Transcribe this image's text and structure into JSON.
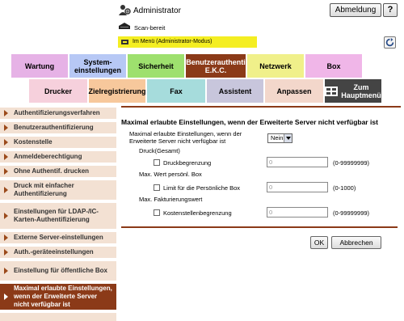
{
  "header": {
    "user": "Administrator",
    "logout_label": "Abmeldung",
    "help_label": "?",
    "status": "Scan-bereit",
    "mode": "Im Menü (Administrator-Modus)"
  },
  "tabs_row1": [
    {
      "label": "Wartung",
      "color": "#e6b2e6"
    },
    {
      "label": "System-\neinstellungen",
      "color": "#b7c8f5"
    },
    {
      "label": "Sicherheit",
      "color": "#9ee06e"
    },
    {
      "label": "Benutzerauthenti\nE.K.C.",
      "color": "#8b3a18",
      "active": true
    },
    {
      "label": "Netzwerk",
      "color": "#f0f08a"
    },
    {
      "label": "Box",
      "color": "#f0b6e8"
    }
  ],
  "tabs_row2": [
    {
      "label": "Drucker",
      "color": "#f6d0dc"
    },
    {
      "label": "Zielregistrierung",
      "color": "#f7c89c"
    },
    {
      "label": "Fax",
      "color": "#a6dcdc"
    },
    {
      "label": "Assistent",
      "color": "#c8c6dc"
    },
    {
      "label": "Anpassen",
      "color": "#f3d7cb"
    },
    {
      "label": "Zum\nHauptmenü",
      "color": "#444444"
    }
  ],
  "sidebar": [
    {
      "label": "Authentifizierungsverfahren"
    },
    {
      "label": "Benutzerauthentifizierung"
    },
    {
      "label": "Kostenstelle"
    },
    {
      "label": "Anmeldeberechtigung"
    },
    {
      "label": "Ohne Authentif. drucken"
    },
    {
      "label": "Druck mit einfacher Authentifizierung"
    },
    {
      "label": "Einstellungen für LDAP-/IC-Karten-Authentifizierung"
    },
    {
      "label": "Externe Server-einstellungen"
    },
    {
      "label": "Auth.-geräteeinstellungen"
    },
    {
      "label": "Einstellung für öffentliche Box"
    },
    {
      "label": "Maximal erlaubte Einstellungen, wenn der Erweiterte Server nicht verfügbar ist",
      "active": true
    }
  ],
  "main": {
    "title": "Maximal erlaubte Einstellungen, wenn der Erweiterte Server nicht verfügbar ist",
    "setting_label": "Maximal erlaubte Einstellungen, wenn der Erweiterte Server nicht verfügbar ist",
    "setting_value": "Nein",
    "group1_title": "Druck(Gesamt)",
    "group1_check": "Druckbegrenzung",
    "group1_value": "0",
    "group1_range": "(0-99999999)",
    "group2_title": "Max. Wert persönl. Box",
    "group2_check": "Limit für die Persönliche Box",
    "group2_value": "0",
    "group2_range": "(0-1000)",
    "group3_title": "Max. Fakturierungswert",
    "group3_check": "Kostenstellenbegrenzung",
    "group3_value": "0",
    "group3_range": "(0-99999999)",
    "ok_label": "OK",
    "cancel_label": "Abbrechen"
  }
}
